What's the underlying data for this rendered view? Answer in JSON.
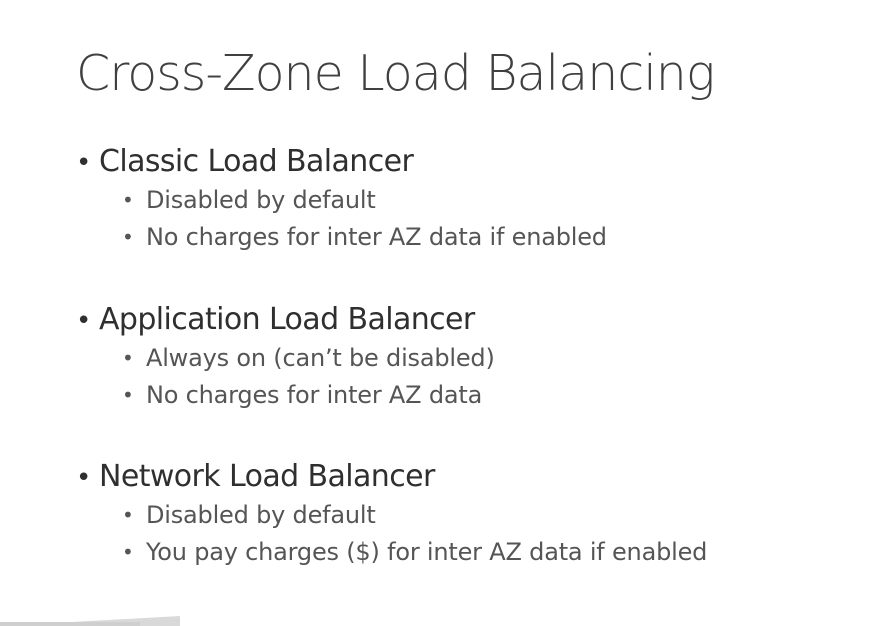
{
  "slide": {
    "title": "Cross-Zone Load Balancing",
    "bullet_glyph": "•",
    "sections": [
      {
        "heading": "Classic Load Balancer",
        "items": [
          "Disabled by default",
          "No charges for inter AZ data if enabled"
        ]
      },
      {
        "heading": "Application Load Balancer",
        "items": [
          "Always on (can’t be disabled)",
          "No charges for inter AZ data"
        ]
      },
      {
        "heading": "Network Load Balancer",
        "items": [
          "Disabled by default",
          "You pay charges ($) for inter AZ data if enabled"
        ]
      }
    ]
  },
  "colors": {
    "title": "#404040",
    "heading": "#2f2f2f",
    "subitem": "#555555",
    "background": "#ffffff"
  }
}
